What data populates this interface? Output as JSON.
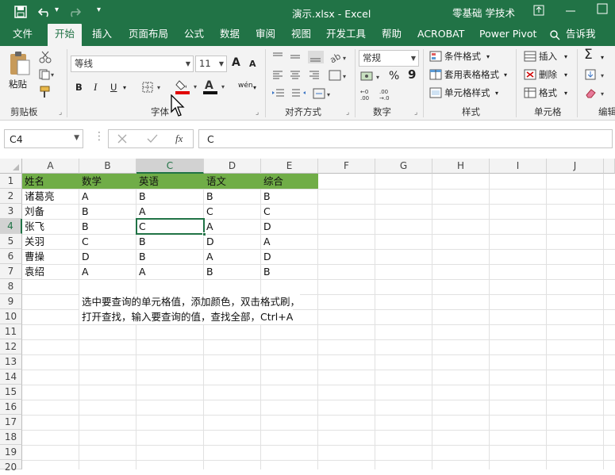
{
  "titlebar": {
    "title": "演示.xlsx  -  Excel",
    "user": "零基础 学技术",
    "undo_dd": "▾",
    "custom_dd": "▾"
  },
  "tabs": [
    {
      "label": "文件"
    },
    {
      "label": "开始"
    },
    {
      "label": "插入"
    },
    {
      "label": "页面布局"
    },
    {
      "label": "公式"
    },
    {
      "label": "数据"
    },
    {
      "label": "审阅"
    },
    {
      "label": "视图"
    },
    {
      "label": "开发工具"
    },
    {
      "label": "帮助"
    },
    {
      "label": "ACROBAT"
    },
    {
      "label": "Power Pivot"
    },
    {
      "label": "告诉我"
    }
  ],
  "ribbon": {
    "clipboard": {
      "paste": "粘贴",
      "label": "剪贴板"
    },
    "font": {
      "name": "等线",
      "size": "11",
      "bold": "B",
      "italic": "I",
      "underline": "U",
      "grow": "A",
      "shrink": "A",
      "wen": "wén",
      "label": "字体"
    },
    "align": {
      "label": "对齐方式"
    },
    "number": {
      "format": "常规",
      "percent": "%",
      "comma": "9",
      "label": "数字"
    },
    "styles": {
      "cond": "条件格式",
      "table": "套用表格格式",
      "cell": "单元格样式",
      "label": "样式"
    },
    "cells": {
      "insert": "插入",
      "delete": "删除",
      "format": "格式",
      "label": "单元格"
    },
    "edit": {
      "sigma": "Σ",
      "label": "编辑"
    }
  },
  "formula_bar": {
    "name_box": "C4",
    "fx": "fx",
    "value": "C"
  },
  "columns": [
    "A",
    "B",
    "C",
    "D",
    "E",
    "F",
    "G",
    "H",
    "I",
    "J"
  ],
  "rows": [
    "1",
    "2",
    "3",
    "4",
    "5",
    "6",
    "7",
    "8",
    "9",
    "10",
    "11",
    "12",
    "13",
    "14",
    "15",
    "16",
    "17",
    "18",
    "19",
    "20"
  ],
  "table": {
    "header": [
      "姓名",
      "数学",
      "英语",
      "语文",
      "综合"
    ],
    "rows": [
      [
        "诸葛亮",
        "A",
        "B",
        "B",
        "B"
      ],
      [
        "刘备",
        "B",
        "A",
        "C",
        "C"
      ],
      [
        "张飞",
        "B",
        "C",
        "A",
        "D"
      ],
      [
        "关羽",
        "C",
        "B",
        "D",
        "A"
      ],
      [
        "曹操",
        "D",
        "B",
        "A",
        "D"
      ],
      [
        "袁绍",
        "A",
        "A",
        "B",
        "B"
      ]
    ]
  },
  "notes": {
    "r9": "选中要查询的单元格值，添加颜色，双击格式刷，",
    "r10": "打开查找，输入要查询的值，查找全部，Ctrl+A"
  },
  "colors": {
    "excel_green": "#217346",
    "header_fill": "#70ad47",
    "selection": "#217346",
    "font_red": "#e00000"
  }
}
